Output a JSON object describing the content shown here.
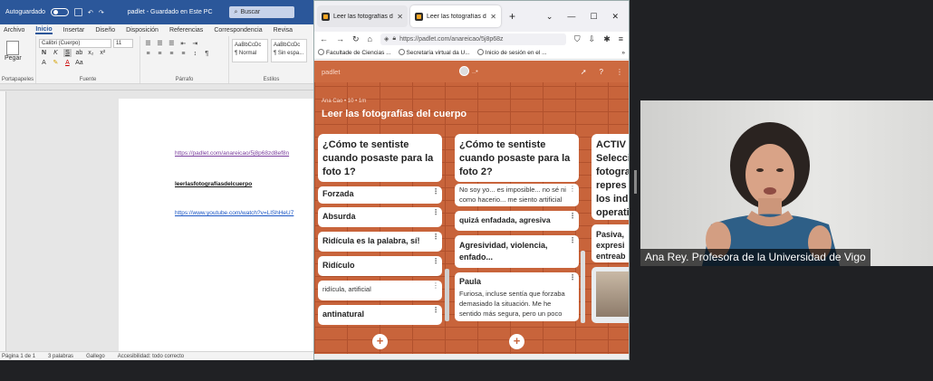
{
  "word": {
    "autosave_label": "Autoguardado",
    "doc_title": "padlet - Guardado en Este PC",
    "search_placeholder": "Buscar",
    "tabs": [
      "Archivo",
      "Inicio",
      "Insertar",
      "Diseño",
      "Disposición",
      "Referencias",
      "Correspondencia",
      "Revisa"
    ],
    "active_tab": "Inicio",
    "ribbon": {
      "paste_label": "Pegar",
      "font_name": "Calibri (Cuerpo)",
      "font_size": "11",
      "style_normal_preview": "AaBbCcDc",
      "style_normal_name": "¶ Normal",
      "style_nospace_preview": "AaBbCcDc",
      "style_nospace_name": "¶ Sin espa...",
      "groups": {
        "clipboard": "Portapapeles",
        "font": "Fuente",
        "paragraph": "Párrafo",
        "styles": "Estilos"
      }
    },
    "document": {
      "line1": "https://padlet.com/anareicao/5j8p68zd8ef8n",
      "line2": "leerlasfotografíasdelcuerpo",
      "line3": "https://www.youtube.com/watch?v=LlShHeU7"
    },
    "status": {
      "page": "Página 1 de 1",
      "words": "3 palabras",
      "language": "Gallego",
      "accessibility": "Accesibilidad: todo correcto"
    }
  },
  "browser": {
    "tabs": [
      {
        "title": "Leer las fotografías del cu",
        "active": false
      },
      {
        "title": "Leer las fotografías del cu",
        "active": true
      }
    ],
    "url": "https://padlet.com/anareicao/5j8p68z",
    "bookmarks": [
      "Facultade de Ciencias ...",
      "Secretaría virtual da U...",
      "Inicio de sesión en el ..."
    ]
  },
  "padlet": {
    "brand": "padlet",
    "meta": "Ana Cao  •  10  •  1m",
    "title": "Leer las fotografías del cuerpo",
    "columns": [
      {
        "heading": "¿Cómo te sentiste cuando posaste para la foto 1?",
        "posts": [
          "Forzada",
          "Absurda",
          "Ridícula es la palabra, sí!",
          "Ridículo",
          "ridícula, artificial",
          "antinatural"
        ]
      },
      {
        "heading": "¿Cómo te sentiste cuando posaste para la foto 2?",
        "posts": [
          "No soy yo... es imposible... no sé ni como hacerio... me siento artificial",
          "quizá enfadada, agresiva",
          "Agresividad, violencia, enfado...",
          "Paula",
          "Furiosa, incluse sentía que forzaba demasiado la situación. Me he sentido más segura, pero un poco"
        ]
      },
      {
        "heading": "ACTIV Selecci fotogra repres los indi operati",
        "posts": [
          "Pasiva, expresi entreab"
        ]
      }
    ]
  },
  "video": {
    "caption": "Ana Rey. Profesora de la Universidad de Vigo"
  }
}
